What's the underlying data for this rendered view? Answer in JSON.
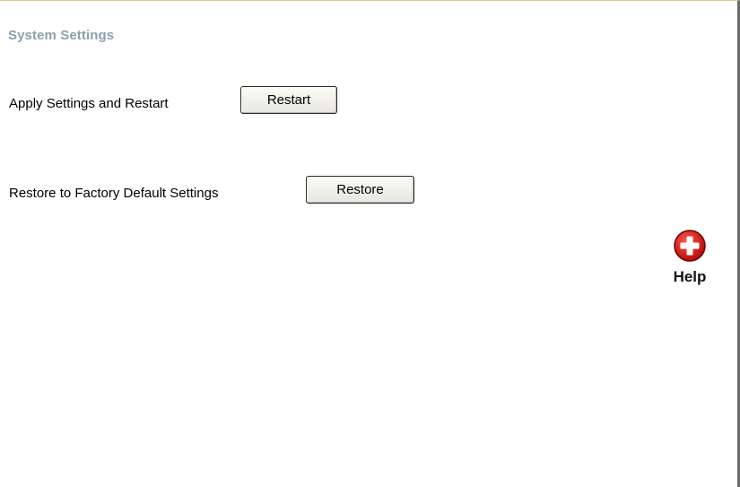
{
  "section": {
    "title": "System Settings"
  },
  "restart": {
    "label": "Apply Settings and Restart",
    "button": "Restart"
  },
  "restore": {
    "label": "Restore to Factory Default Settings",
    "button": "Restore"
  },
  "help": {
    "icon": "plus-circle-icon",
    "label": "Help",
    "icon_color": "#cc1111"
  }
}
